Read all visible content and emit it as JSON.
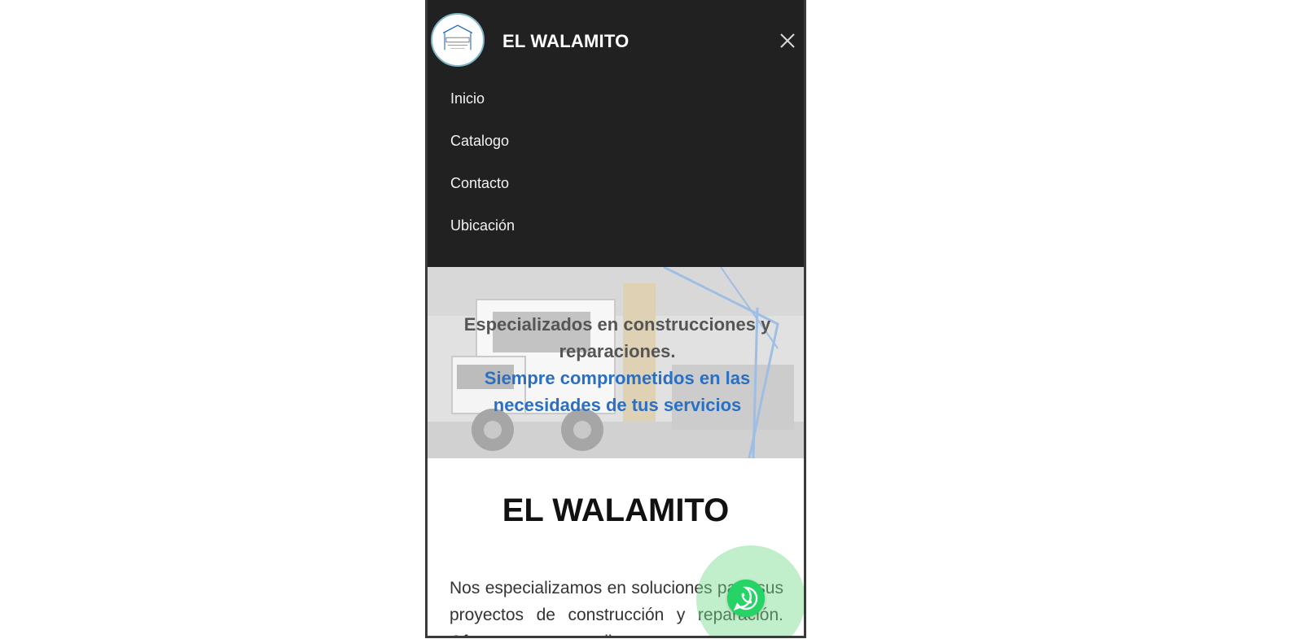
{
  "header": {
    "brand": "EL WALAMITO",
    "logo_icon": "el-walamito-logo",
    "close_icon": "close-icon"
  },
  "nav": {
    "items": [
      {
        "label": "Inicio"
      },
      {
        "label": "Catalogo"
      },
      {
        "label": "Contacto"
      },
      {
        "label": "Ubicación"
      }
    ]
  },
  "hero": {
    "line1": "Especializados en construcciones y reparaciones.",
    "line2": "Siempre comprometidos en las necesidades de tus servicios",
    "line1_color": "#555555",
    "line2_color": "#2a6fc2"
  },
  "main": {
    "title": "EL WALAMITO",
    "body": "Nos especializamos en soluciones para sus proyectos de construcción y reparación. Ofrecemos una amplia"
  },
  "whatsapp": {
    "icon": "whatsapp-icon",
    "color": "#25d366"
  }
}
